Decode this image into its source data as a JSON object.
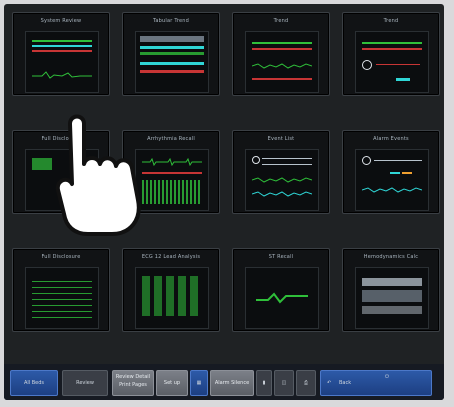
{
  "tiles": [
    {
      "label": "System Review"
    },
    {
      "label": "Tabular Trend"
    },
    {
      "label": "Trend"
    },
    {
      "label": "Trend"
    },
    {
      "label": "Full Disclosure"
    },
    {
      "label": "Arrhythmia Recall"
    },
    {
      "label": "Event List"
    },
    {
      "label": "Alarm Events"
    },
    {
      "label": "Full Disclosure"
    },
    {
      "label": "ECG 12 Lead Analysis"
    },
    {
      "label": "ST Recall"
    },
    {
      "label": "Hemodynamics Calc"
    }
  ],
  "taskbar": {
    "all_beds": "All Beds",
    "review": "Review",
    "review_detail": "Review Detail",
    "print_pages": "Print Pages",
    "setup": "Set up",
    "alarm_silence": "Alarm Silence",
    "back": "Back"
  },
  "colors": {
    "accent": "#2d5aa8",
    "wave_green": "#2fbf3a",
    "wave_cyan": "#2fd6d6",
    "wave_red": "#c73535"
  }
}
